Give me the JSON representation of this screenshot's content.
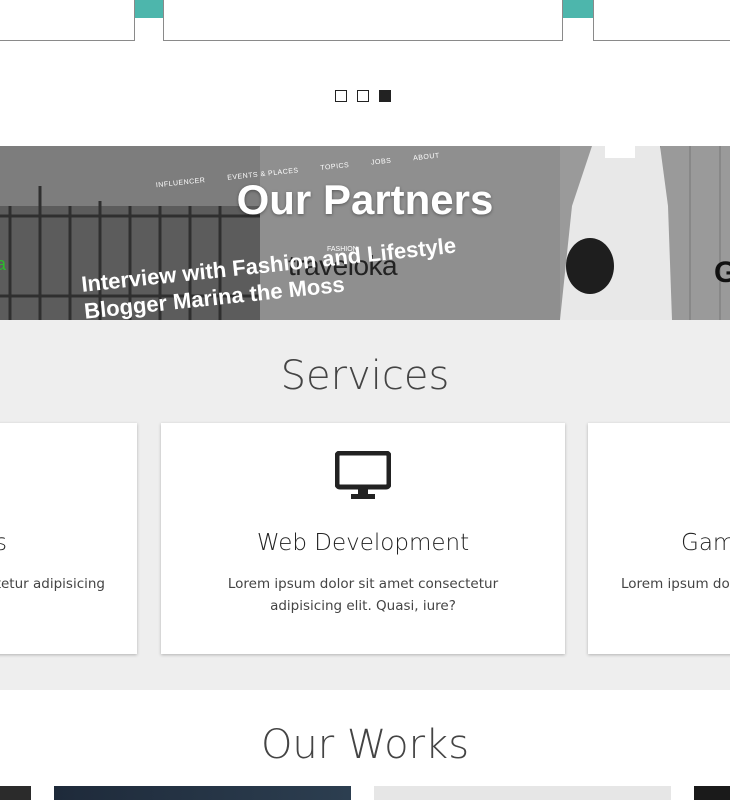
{
  "carousel": {
    "dots": [
      {
        "label": "slide 1",
        "active": false
      },
      {
        "label": "slide 2",
        "active": false
      },
      {
        "label": "slide 3",
        "active": true
      }
    ]
  },
  "partners": {
    "title": "Our Partners",
    "banner_nav": [
      "INFLUENCER",
      "EVENTS & PLACES",
      "TOPICS",
      "JOBS",
      "ABOUT"
    ],
    "banner_tag": "FASHION",
    "banner_logo": "traveloka",
    "banner_headline_1": "Interview with Fashion and Lifestyle",
    "banner_headline_2": "Blogger Marina the Moss"
  },
  "services": {
    "title": "Services",
    "cards": [
      {
        "heading": "s",
        "text": "tetur adipisicing",
        "icon": "none"
      },
      {
        "heading": "Web Development",
        "text": "Lorem ipsum dolor sit amet consectetur adipisicing elit. Quasi, iure?",
        "icon": "monitor-icon"
      },
      {
        "heading": "Gam",
        "text": "Lorem ipsum dol",
        "icon": "none"
      }
    ]
  },
  "works": {
    "title": "Our Works"
  },
  "colors": {
    "accent": "#4db6ac",
    "services_bg": "#eeeeee",
    "text_dark": "#2a2a2a"
  }
}
